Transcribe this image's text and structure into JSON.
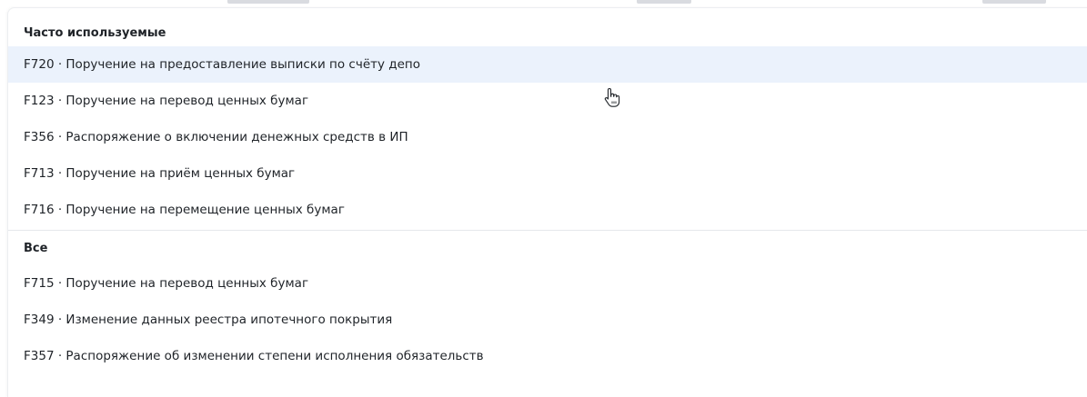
{
  "frequent": {
    "header": "Часто используемые",
    "items": [
      "F720 · Поручение на предоставление выписки по счёту депо",
      "F123 · Поручение на перевод ценных бумаг",
      "F356 · Распоряжение о включении денежных средств в ИП",
      "F713 · Поручение на приём ценных бумаг",
      "F716 · Поручение на перемещение ценных бумаг"
    ]
  },
  "all": {
    "header": "Все",
    "items": [
      "F715 · Поручение на перевод ценных бумаг",
      "F349 · Изменение данных реестра ипотечного покрытия",
      "F357 · Распоряжение об изменении степени исполнения обязательств"
    ]
  },
  "hovered_item": "F720 · Поручение на предоставление выписки по счёту депо",
  "colors": {
    "hover_bg": "#ebf2fc",
    "text": "#1f2328",
    "divider": "#e6e8ec"
  },
  "icons": {
    "cursor": "hand-pointer-icon"
  }
}
